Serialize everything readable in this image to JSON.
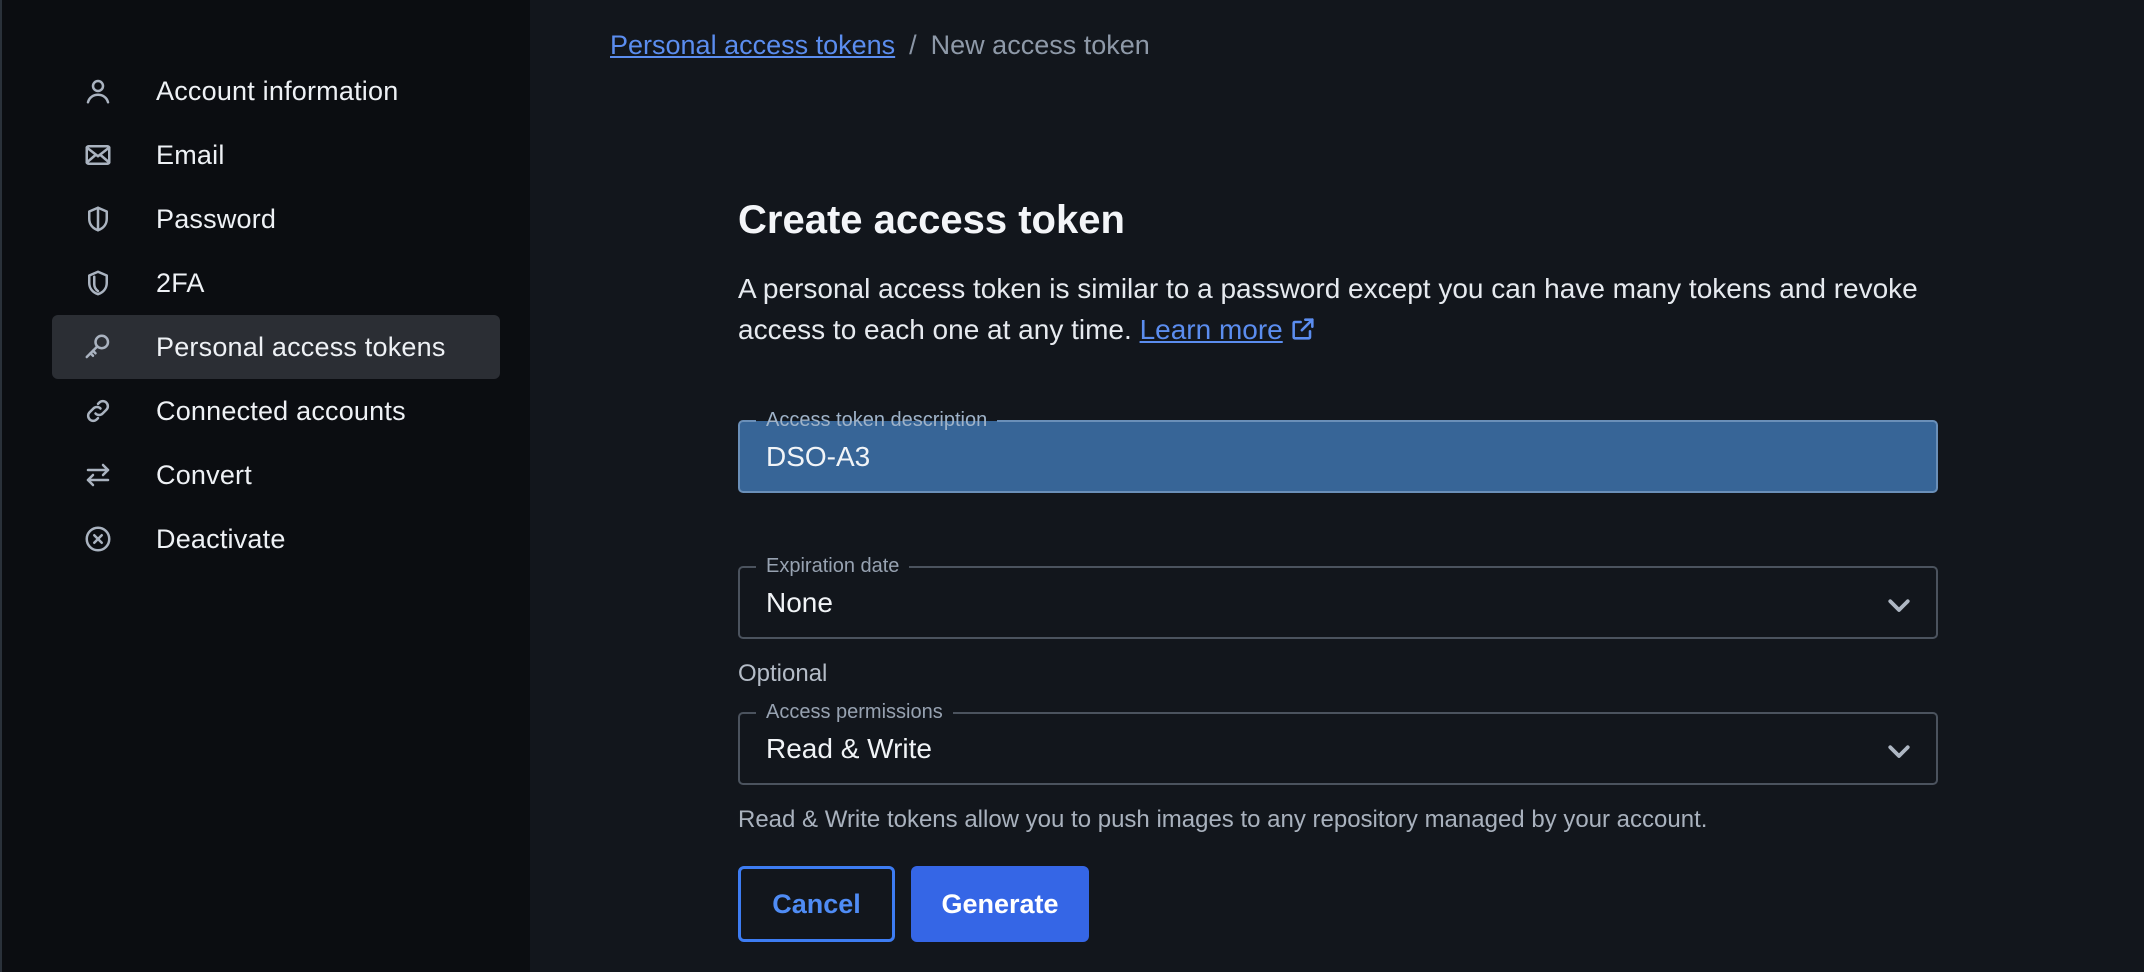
{
  "sidebar": {
    "items": [
      {
        "label": "Account information",
        "icon": "user-icon"
      },
      {
        "label": "Email",
        "icon": "envelope-icon"
      },
      {
        "label": "Password",
        "icon": "shield-half-icon"
      },
      {
        "label": "2FA",
        "icon": "shield-icon"
      },
      {
        "label": "Personal access tokens",
        "icon": "key-icon",
        "active": true
      },
      {
        "label": "Connected accounts",
        "icon": "link-icon"
      },
      {
        "label": "Convert",
        "icon": "swap-arrows-icon"
      },
      {
        "label": "Deactivate",
        "icon": "circle-x-icon"
      }
    ]
  },
  "breadcrumb": {
    "parent": "Personal access tokens",
    "separator": "/",
    "current": "New access token"
  },
  "form": {
    "title": "Create access token",
    "description": "A personal access token is similar to a password except you can have many tokens and revoke access to each one at any time.",
    "learn_more": "Learn more",
    "description_field": {
      "label": "Access token description",
      "value": "DSO-A3"
    },
    "expiration_field": {
      "label": "Expiration date",
      "value": "None"
    },
    "optional_label": "Optional",
    "permissions_field": {
      "label": "Access permissions",
      "value": "Read & Write"
    },
    "permissions_helper": "Read & Write tokens allow you to push images to any repository managed by your account.",
    "cancel_label": "Cancel",
    "generate_label": "Generate"
  },
  "colors": {
    "background": "#12161c",
    "sidebar": "#0b0d11",
    "accent": "#3566e6",
    "link": "#5b8def",
    "focused_field": "#376597"
  }
}
